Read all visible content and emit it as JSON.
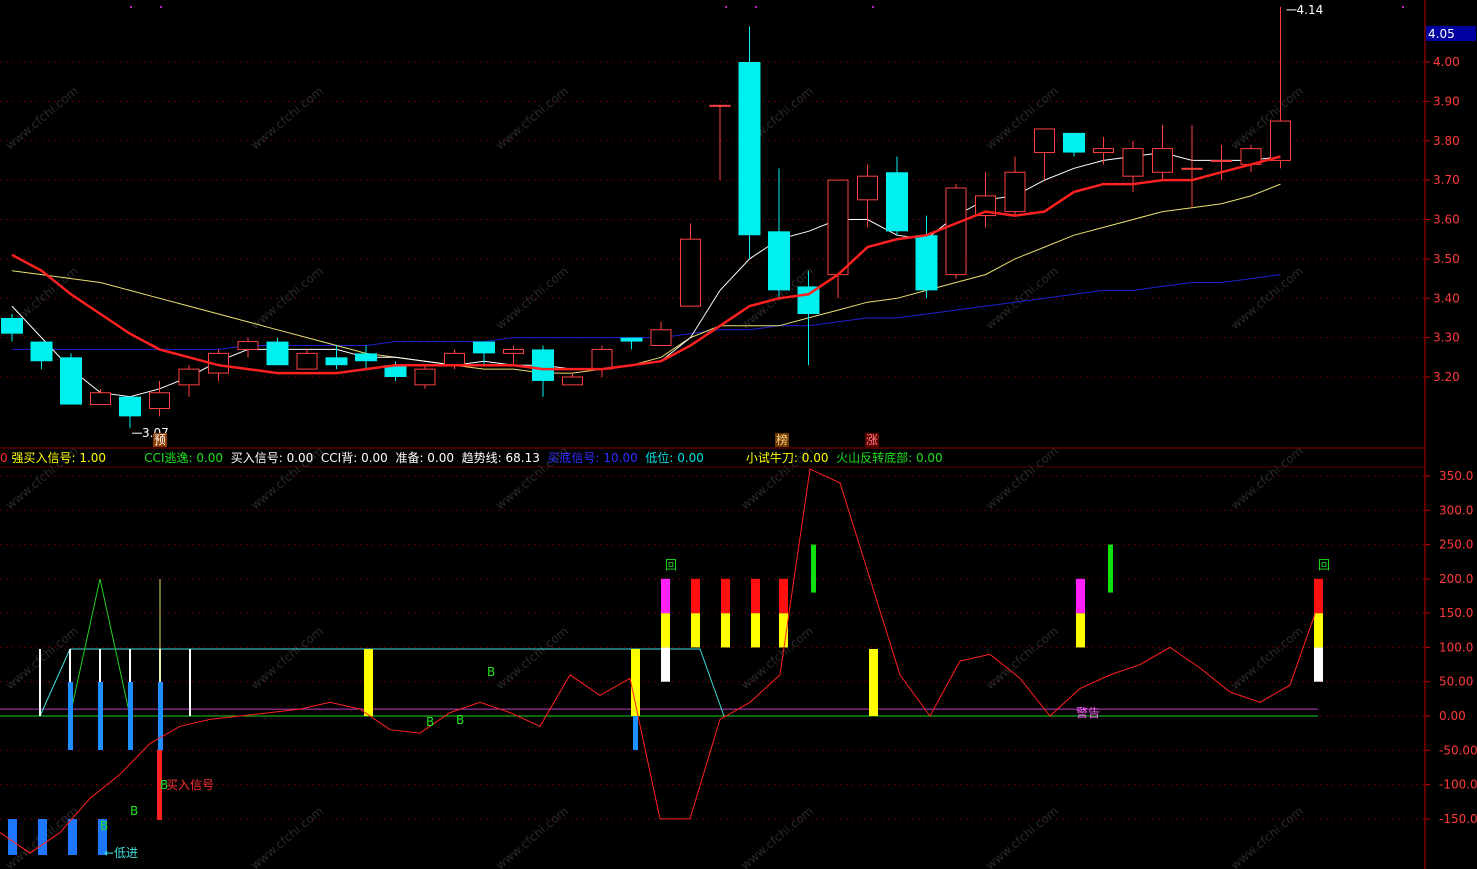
{
  "colors": {
    "background": "#000000",
    "up": "#ff4040",
    "down": "#00f0f0",
    "ma_white": "#ffffff",
    "ma_red": "#ff2020",
    "ma_yellow": "#e8e070",
    "ma_blue": "#2020d0",
    "axis": "#c00000"
  },
  "price_axis": {
    "ticks": [
      "4.00",
      "3.90",
      "3.80",
      "3.70",
      "3.60",
      "3.50",
      "3.40",
      "3.30",
      "3.20"
    ],
    "current_price": "4.05",
    "high_label": "4.14",
    "low_label": "3.07"
  },
  "indicator_axis": {
    "ticks": [
      "350.0",
      "300.0",
      "250.0",
      "200.0",
      "150.0",
      "100.0",
      "50.00",
      "0.00",
      "-50.00",
      "-100.0",
      "-150.0"
    ]
  },
  "indicator_bar": [
    {
      "text": "0",
      "color": "#ff3030"
    },
    {
      "text": " 强买入信号: 1.00",
      "color": "#ffff00"
    },
    {
      "text": "          CCI逃逸: 0.00",
      "color": "#20e020"
    },
    {
      "text": "  买入信号: 0.00",
      "color": "#ffffff"
    },
    {
      "text": "  CCI背: 0.00",
      "color": "#ffffff"
    },
    {
      "text": "  准备: 0.00",
      "color": "#ffffff"
    },
    {
      "text": "  趋势线: 68.13",
      "color": "#ffffff"
    },
    {
      "text": "  买底信号: 10.00",
      "color": "#3030ff"
    },
    {
      "text": "  低位: 0.00",
      "color": "#00e0e0"
    },
    {
      "text": "           小试牛刀: 0.00",
      "color": "#ffff00"
    },
    {
      "text": "  火山反转底部: 0.00",
      "color": "#20e020"
    }
  ],
  "markers": {
    "yu": "预",
    "bang": "榜",
    "zhang": "涨",
    "hui": "回",
    "buy_signal": "买入信号",
    "low_entry": "低进",
    "b": "B",
    "warning": "警告"
  },
  "watermark": "www.cfchi.com",
  "chart_data": {
    "type": "candlestick",
    "ylim": [
      3.1,
      4.18
    ],
    "candles": [
      {
        "o": 3.35,
        "c": 3.31,
        "h": 3.36,
        "l": 3.29
      },
      {
        "o": 3.29,
        "c": 3.24,
        "h": 3.29,
        "l": 3.22
      },
      {
        "o": 3.25,
        "c": 3.13,
        "h": 3.26,
        "l": 3.13
      },
      {
        "o": 3.13,
        "c": 3.16,
        "h": 3.17,
        "l": 3.13
      },
      {
        "o": 3.15,
        "c": 3.1,
        "h": 3.15,
        "l": 3.07
      },
      {
        "o": 3.12,
        "c": 3.16,
        "h": 3.19,
        "l": 3.1
      },
      {
        "o": 3.18,
        "c": 3.22,
        "h": 3.23,
        "l": 3.15
      },
      {
        "o": 3.21,
        "c": 3.26,
        "h": 3.27,
        "l": 3.19
      },
      {
        "o": 3.27,
        "c": 3.29,
        "h": 3.3,
        "l": 3.25
      },
      {
        "o": 3.29,
        "c": 3.23,
        "h": 3.3,
        "l": 3.23
      },
      {
        "o": 3.22,
        "c": 3.26,
        "h": 3.27,
        "l": 3.22
      },
      {
        "o": 3.25,
        "c": 3.23,
        "h": 3.28,
        "l": 3.22
      },
      {
        "o": 3.26,
        "c": 3.24,
        "h": 3.28,
        "l": 3.22
      },
      {
        "o": 3.23,
        "c": 3.2,
        "h": 3.24,
        "l": 3.19
      },
      {
        "o": 3.18,
        "c": 3.22,
        "h": 3.23,
        "l": 3.17
      },
      {
        "o": 3.23,
        "c": 3.26,
        "h": 3.27,
        "l": 3.22
      },
      {
        "o": 3.29,
        "c": 3.26,
        "h": 3.29,
        "l": 3.23
      },
      {
        "o": 3.26,
        "c": 3.27,
        "h": 3.28,
        "l": 3.23
      },
      {
        "o": 3.27,
        "c": 3.19,
        "h": 3.28,
        "l": 3.15
      },
      {
        "o": 3.18,
        "c": 3.2,
        "h": 3.21,
        "l": 3.18
      },
      {
        "o": 3.22,
        "c": 3.27,
        "h": 3.28,
        "l": 3.2
      },
      {
        "o": 3.3,
        "c": 3.29,
        "h": 3.3,
        "l": 3.27
      },
      {
        "o": 3.28,
        "c": 3.32,
        "h": 3.34,
        "l": 3.28
      },
      {
        "o": 3.38,
        "c": 3.55,
        "h": 3.59,
        "l": 3.38
      },
      {
        "o": 3.89,
        "c": 3.89,
        "h": 3.89,
        "l": 3.7
      },
      {
        "o": 4.0,
        "c": 3.56,
        "h": 4.09,
        "l": 3.5
      },
      {
        "o": 3.57,
        "c": 3.42,
        "h": 3.73,
        "l": 3.4
      },
      {
        "o": 3.43,
        "c": 3.36,
        "h": 3.47,
        "l": 3.23
      },
      {
        "o": 3.46,
        "c": 3.7,
        "h": 3.7,
        "l": 3.4
      },
      {
        "o": 3.65,
        "c": 3.71,
        "h": 3.74,
        "l": 3.58
      },
      {
        "o": 3.72,
        "c": 3.57,
        "h": 3.76,
        "l": 3.56
      },
      {
        "o": 3.56,
        "c": 3.42,
        "h": 3.61,
        "l": 3.4
      },
      {
        "o": 3.46,
        "c": 3.68,
        "h": 3.69,
        "l": 3.45
      },
      {
        "o": 3.61,
        "c": 3.66,
        "h": 3.72,
        "l": 3.58
      },
      {
        "o": 3.62,
        "c": 3.72,
        "h": 3.76,
        "l": 3.61
      },
      {
        "o": 3.77,
        "c": 3.83,
        "h": 3.83,
        "l": 3.7
      },
      {
        "o": 3.82,
        "c": 3.77,
        "h": 3.82,
        "l": 3.76
      },
      {
        "o": 3.77,
        "c": 3.78,
        "h": 3.81,
        "l": 3.74
      },
      {
        "o": 3.71,
        "c": 3.78,
        "h": 3.8,
        "l": 3.67
      },
      {
        "o": 3.72,
        "c": 3.78,
        "h": 3.84,
        "l": 3.7
      },
      {
        "o": 3.73,
        "c": 3.73,
        "h": 3.84,
        "l": 3.63
      },
      {
        "o": 3.75,
        "c": 3.75,
        "h": 3.79,
        "l": 3.7
      },
      {
        "o": 3.74,
        "c": 3.78,
        "h": 3.79,
        "l": 3.72
      },
      {
        "o": 3.75,
        "c": 3.85,
        "h": 4.14,
        "l": 3.73
      }
    ],
    "ma_white": [
      3.38,
      3.3,
      3.22,
      3.16,
      3.15,
      3.17,
      3.2,
      3.24,
      3.27,
      3.27,
      3.27,
      3.27,
      3.25,
      3.25,
      3.24,
      3.23,
      3.24,
      3.23,
      3.23,
      3.22,
      3.22,
      3.23,
      3.24,
      3.3,
      3.42,
      3.5,
      3.55,
      3.57,
      3.6,
      3.6,
      3.56,
      3.55,
      3.61,
      3.65,
      3.66,
      3.7,
      3.73,
      3.75,
      3.76,
      3.77,
      3.75,
      3.75,
      3.75,
      3.76
    ],
    "ma_red": [
      3.51,
      3.47,
      3.41,
      3.36,
      3.31,
      3.27,
      3.25,
      3.23,
      3.22,
      3.21,
      3.21,
      3.21,
      3.22,
      3.23,
      3.23,
      3.23,
      3.23,
      3.23,
      3.22,
      3.22,
      3.22,
      3.23,
      3.24,
      3.28,
      3.33,
      3.38,
      3.4,
      3.41,
      3.46,
      3.53,
      3.55,
      3.56,
      3.59,
      3.62,
      3.61,
      3.62,
      3.67,
      3.69,
      3.69,
      3.7,
      3.7,
      3.72,
      3.74,
      3.76
    ],
    "ma_yellow": [
      3.47,
      3.46,
      3.45,
      3.44,
      3.42,
      3.4,
      3.38,
      3.36,
      3.34,
      3.32,
      3.3,
      3.28,
      3.26,
      3.25,
      3.24,
      3.23,
      3.22,
      3.22,
      3.21,
      3.21,
      3.22,
      3.23,
      3.25,
      3.3,
      3.33,
      3.33,
      3.33,
      3.35,
      3.37,
      3.39,
      3.4,
      3.42,
      3.44,
      3.46,
      3.5,
      3.53,
      3.56,
      3.58,
      3.6,
      3.62,
      3.63,
      3.64,
      3.66,
      3.69
    ],
    "ma_blue": [
      3.27,
      3.27,
      3.27,
      3.27,
      3.27,
      3.27,
      3.27,
      3.27,
      3.28,
      3.28,
      3.28,
      3.28,
      3.28,
      3.29,
      3.29,
      3.29,
      3.29,
      3.3,
      3.3,
      3.3,
      3.3,
      3.3,
      3.3,
      3.31,
      3.32,
      3.32,
      3.33,
      3.33,
      3.34,
      3.35,
      3.35,
      3.36,
      3.37,
      3.38,
      3.39,
      3.4,
      3.41,
      3.42,
      3.42,
      3.43,
      3.44,
      3.44,
      3.45,
      3.46
    ],
    "indicator": {
      "ylim": [
        -200,
        370
      ],
      "red_line": [
        -170,
        -200,
        -170,
        -120,
        -85,
        -40,
        -15,
        -5,
        0,
        5,
        10,
        20,
        10,
        -20,
        -25,
        5,
        20,
        5,
        -15,
        60,
        30,
        55,
        -150,
        -150,
        -5,
        20,
        60,
        360,
        340,
        200,
        60,
        0,
        80,
        90,
        55,
        0,
        40,
        60,
        75,
        100,
        70,
        35,
        20,
        45,
        170
      ],
      "cyan_box": [
        0,
        100
      ],
      "green_zigzag": [
        0,
        100,
        0,
        200,
        0,
        100,
        0
      ]
    }
  }
}
